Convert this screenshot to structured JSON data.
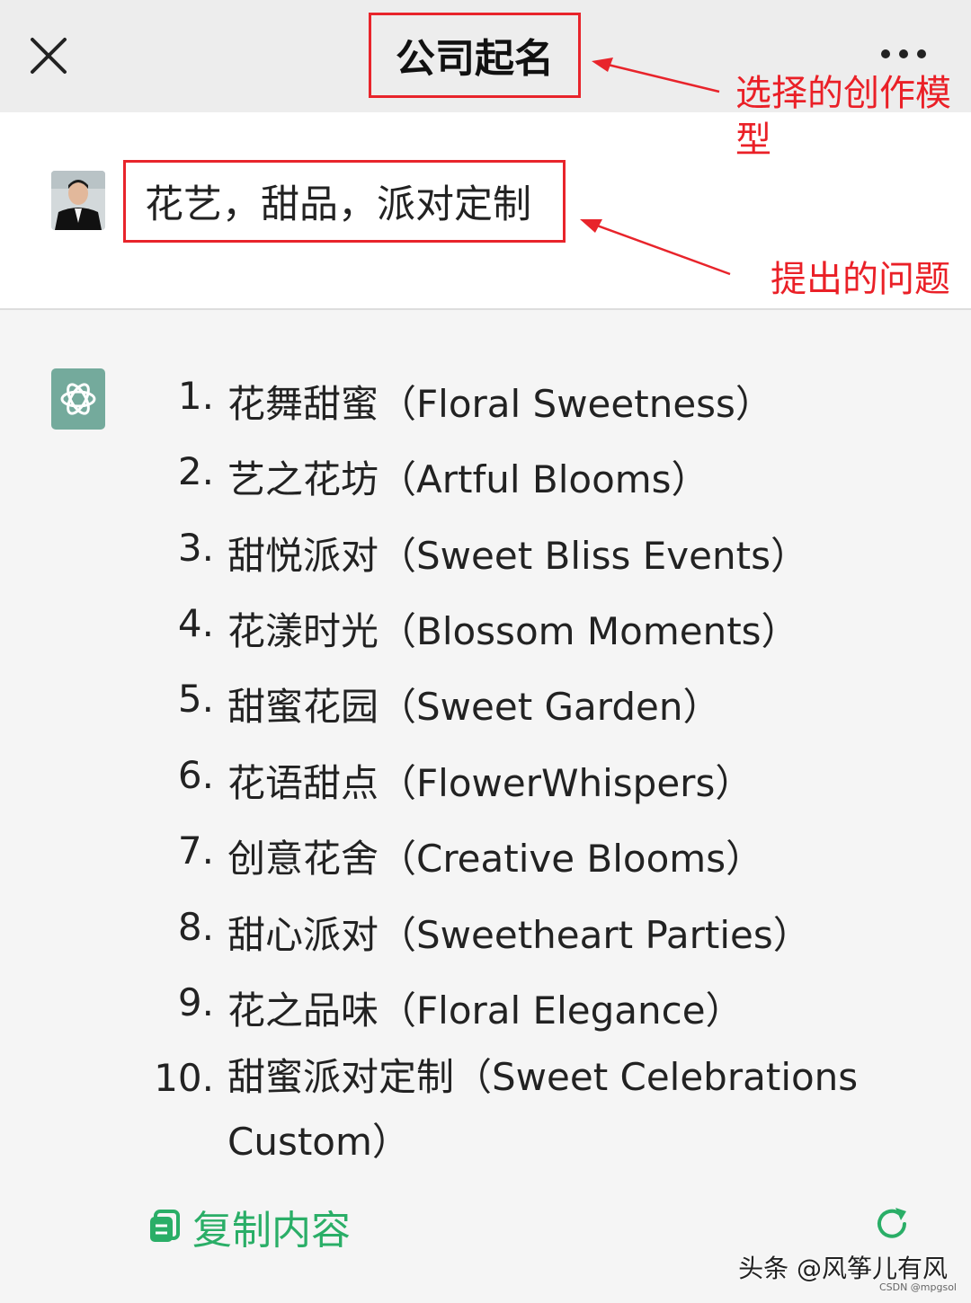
{
  "header": {
    "title": "公司起名"
  },
  "question": {
    "text": "花艺，甜品，派对定制"
  },
  "answer": {
    "items": [
      {
        "num": "1.",
        "text": "花舞甜蜜（Floral Sweetness）"
      },
      {
        "num": "2.",
        "text": "艺之花坊（Artful Blooms）"
      },
      {
        "num": "3.",
        "text": "甜悦派对（Sweet Bliss Events）"
      },
      {
        "num": "4.",
        "text": "花漾时光（Blossom Moments）"
      },
      {
        "num": "5.",
        "text": "甜蜜花园（Sweet Garden）"
      },
      {
        "num": "6.",
        "text": "花语甜点（FlowerWhispers）"
      },
      {
        "num": "7.",
        "text": "创意花舍（Creative Blooms）"
      },
      {
        "num": "8.",
        "text": "甜心派对（Sweetheart Parties）"
      },
      {
        "num": "9.",
        "text": "花之品味（Floral Elegance）"
      },
      {
        "num": "10.",
        "text": "甜蜜派对定制（Sweet Celebrations Custom）"
      }
    ]
  },
  "actions": {
    "copy_label": "复制内容"
  },
  "annotations": {
    "model_label": "选择的创作模型",
    "question_label": "提出的问题"
  },
  "watermark": {
    "text": "头条 @风筝儿有风",
    "csdn": "CSDN @mpgsol"
  },
  "colors": {
    "accent_green": "#2aae67",
    "annotation_red": "#e8242b",
    "bot_avatar": "#74aa9c",
    "topbar_bg": "#ededed"
  },
  "icons": {
    "close": "close-icon",
    "more": "more-dots-icon",
    "copy": "copy-icon",
    "refresh": "refresh-icon",
    "bot": "openai-logo-icon"
  }
}
